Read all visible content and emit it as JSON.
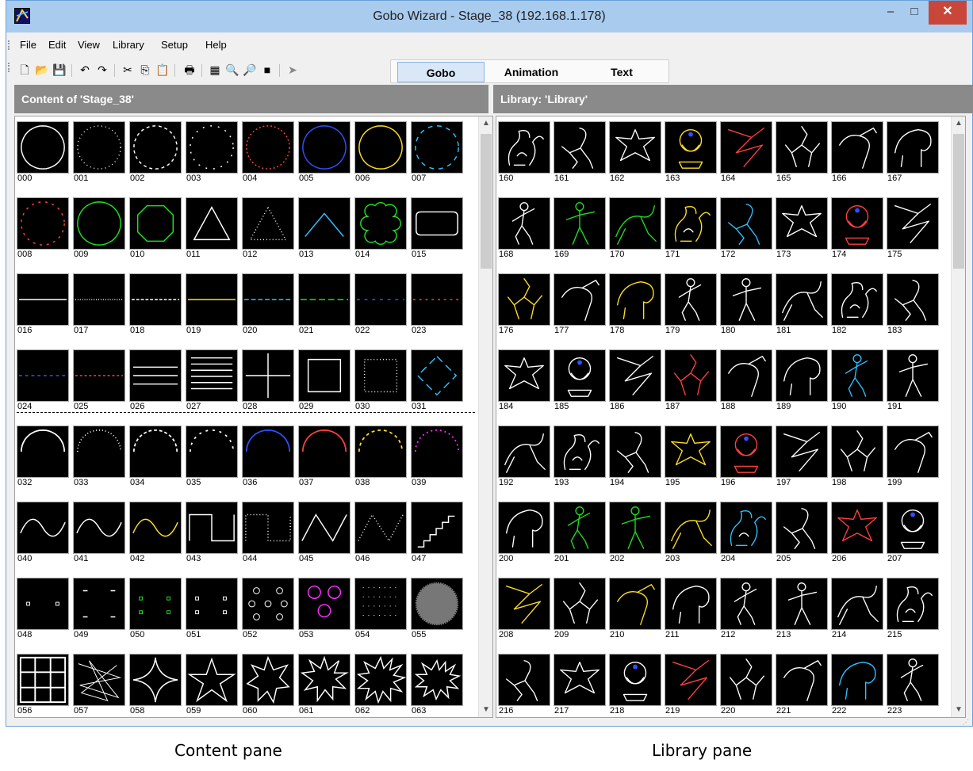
{
  "window": {
    "title": "Gobo Wizard - Stage_38 (192.168.1.178)",
    "min_label": "–",
    "max_label": "□",
    "close_label": "✕"
  },
  "menu": [
    "File",
    "Edit",
    "View",
    "Library",
    "Setup",
    "Help"
  ],
  "toolbar": {
    "icons": [
      "new-file-icon",
      "open-folder-icon",
      "save-icon",
      "undo-icon",
      "redo-icon",
      "cut-icon",
      "copy-icon",
      "paste-icon",
      "print-icon",
      "grid-view-icon",
      "zoom-out-icon",
      "zoom-in-icon",
      "fill-icon",
      "send-icon"
    ],
    "glyphs": [
      "🗋",
      "📂",
      "💾",
      "↶",
      "↷",
      "✂",
      "⎘",
      "📋",
      "🖶",
      "▦",
      "🔍",
      "🔎",
      "■",
      "➤"
    ]
  },
  "mode_tabs": {
    "items": [
      "Gobo",
      "Animation",
      "Text"
    ],
    "active": "Gobo"
  },
  "content_pane": {
    "header": "Content of 'Stage_38'",
    "items": [
      "000",
      "001",
      "002",
      "003",
      "004",
      "005",
      "006",
      "007",
      "008",
      "009",
      "010",
      "011",
      "012",
      "013",
      "014",
      "015",
      "016",
      "017",
      "018",
      "019",
      "020",
      "021",
      "022",
      "023",
      "024",
      "025",
      "026",
      "027",
      "028",
      "029",
      "030",
      "031",
      "032",
      "033",
      "034",
      "035",
      "036",
      "037",
      "038",
      "039",
      "040",
      "041",
      "042",
      "043",
      "044",
      "045",
      "046",
      "047",
      "048",
      "049",
      "050",
      "051",
      "052",
      "053",
      "054",
      "055",
      "056",
      "057",
      "058",
      "059",
      "060",
      "061",
      "062",
      "063"
    ]
  },
  "library_pane": {
    "header": "Library: 'Library'",
    "items": [
      "160",
      "161",
      "162",
      "163",
      "164",
      "165",
      "166",
      "167",
      "168",
      "169",
      "170",
      "171",
      "172",
      "173",
      "174",
      "175",
      "176",
      "177",
      "178",
      "179",
      "180",
      "181",
      "182",
      "183",
      "184",
      "185",
      "186",
      "187",
      "188",
      "189",
      "190",
      "191",
      "192",
      "193",
      "194",
      "195",
      "196",
      "197",
      "198",
      "199",
      "200",
      "201",
      "202",
      "203",
      "204",
      "205",
      "206",
      "207",
      "208",
      "209",
      "210",
      "211",
      "212",
      "213",
      "214",
      "215",
      "216",
      "217",
      "218",
      "219",
      "220",
      "221",
      "222",
      "223"
    ]
  },
  "captions": {
    "content": "Content pane",
    "library": "Library pane"
  },
  "colors": {
    "title_bar": "#a9cbee",
    "close_button": "#c9473a",
    "pane_header": "#8a8a8a",
    "active_tab": "#d9e7f7"
  }
}
